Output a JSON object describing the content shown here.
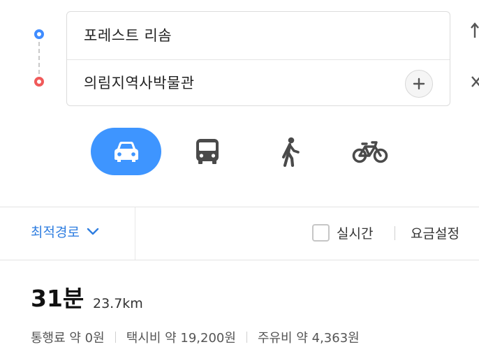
{
  "route": {
    "origin": "포레스트 리솜",
    "destination": "의림지역사박물관"
  },
  "icons": {
    "origin_marker": "origin-dot-icon",
    "destination_marker": "destination-dot-icon",
    "add": "plus-icon",
    "swap": "swap-arrows-icon",
    "close": "close-icon"
  },
  "modes": [
    {
      "id": "car",
      "icon": "car-icon",
      "selected": true
    },
    {
      "id": "bus",
      "icon": "bus-icon",
      "selected": false
    },
    {
      "id": "walk",
      "icon": "walking-person-icon",
      "selected": false
    },
    {
      "id": "bike",
      "icon": "bicycle-icon",
      "selected": false
    }
  ],
  "options": {
    "route_type": "최적경로",
    "realtime_label": "실시간",
    "realtime_checked": false,
    "fare_setting": "요금설정"
  },
  "result": {
    "duration": "31분",
    "distance": "23.7km",
    "toll": "통행료 약 0원",
    "taxi": "택시비 약 19,200원",
    "fuel": "주유비 약 4,363원"
  },
  "colors": {
    "accent": "#3e95ff",
    "link": "#2f7ee0",
    "origin": "#3f8cff",
    "destination": "#f05a5a",
    "icon_gray": "#4a4a4a"
  }
}
